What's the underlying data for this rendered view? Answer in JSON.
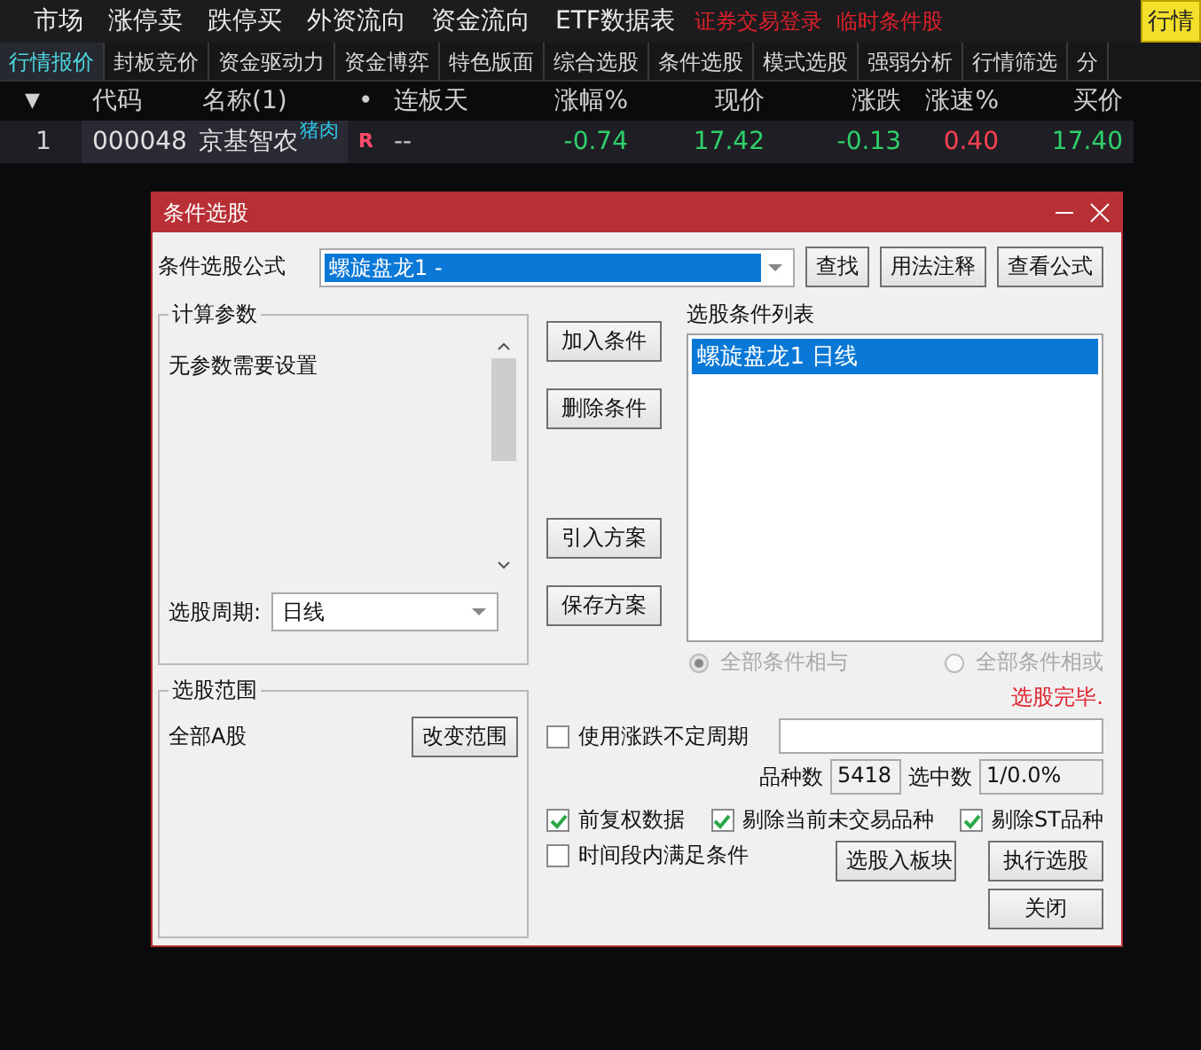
{
  "menu_bar": {
    "items": [
      "市场",
      "涨停卖",
      "跌停买",
      "外资流向",
      "资金流向",
      "ETF数据表"
    ],
    "alert_links": [
      "证券交易登录",
      "临时条件股"
    ],
    "corner_button": "行情"
  },
  "tabs": [
    {
      "label": "行情报价",
      "selected": true
    },
    {
      "label": "封板竞价",
      "selected": false
    },
    {
      "label": "资金驱动力",
      "selected": false
    },
    {
      "label": "资金博弈",
      "selected": false
    },
    {
      "label": "特色版面",
      "selected": false
    },
    {
      "label": "综合选股",
      "selected": false
    },
    {
      "label": "条件选股",
      "selected": false
    },
    {
      "label": "模式选股",
      "selected": false
    },
    {
      "label": "强弱分析",
      "selected": false
    },
    {
      "label": "行情筛选",
      "selected": false
    },
    {
      "label": "分",
      "selected": false
    }
  ],
  "table": {
    "columns": [
      "▼",
      "代码",
      "名称(1)",
      "•",
      "连板天",
      "涨幅%",
      "现价",
      "涨跌",
      "涨速%",
      "买价"
    ],
    "rows": [
      {
        "cells": [
          {
            "kind": "index",
            "text": "1"
          },
          {
            "kind": "code",
            "text": "000048"
          },
          {
            "kind": "name",
            "text": "京基智农",
            "tag": "猪肉"
          },
          {
            "kind": "flag",
            "text": "R"
          },
          {
            "kind": "plain",
            "text": "--"
          },
          {
            "kind": "number",
            "text": "-0.74",
            "rising": false
          },
          {
            "kind": "number",
            "text": "17.42",
            "rising": false
          },
          {
            "kind": "number",
            "text": "-0.13",
            "rising": false
          },
          {
            "kind": "number",
            "text": "0.40",
            "rising": true
          },
          {
            "kind": "number",
            "text": "17.40",
            "rising": false
          }
        ]
      }
    ]
  },
  "dialog": {
    "title": "条件选股",
    "formula_label": "条件选股公式",
    "formula_value": "螺旋盘龙1  -",
    "formula_buttons": [
      "查找",
      "用法注释",
      "查看公式"
    ],
    "params_title": "计算参数",
    "params_text": "无参数需要设置",
    "period_label": "选股周期:",
    "period_value": "日线",
    "scope_title": "选股范围",
    "scope_text": "全部A股",
    "scope_button": "改变范围",
    "middle_buttons": [
      "加入条件",
      "删除条件",
      "引入方案",
      "保存方案"
    ],
    "list_label": "选股条件列表",
    "list_items": [
      {
        "text": "螺旋盘龙1  日线",
        "selected": true
      }
    ],
    "radios": [
      {
        "label": "全部条件相与",
        "selected": true,
        "disabled": true
      },
      {
        "label": "全部条件相或",
        "selected": false,
        "disabled": true
      }
    ],
    "status": "选股完毕.",
    "variable_period": {
      "label": "使用涨跌不定周期",
      "checked": false
    },
    "count_label": "品种数",
    "count_value": "5418",
    "selected_label": "选中数",
    "selected_value": "1/0.0%",
    "options": [
      {
        "label": "前复权数据",
        "checked": true
      },
      {
        "label": "剔除当前未交易品种",
        "checked": true
      },
      {
        "label": "剔除ST品种",
        "checked": true
      }
    ],
    "period_option": {
      "label": "时间段内满足条件",
      "checked": false
    },
    "bottom_buttons": [
      "选股入板块",
      "执行选股",
      "关闭"
    ]
  }
}
